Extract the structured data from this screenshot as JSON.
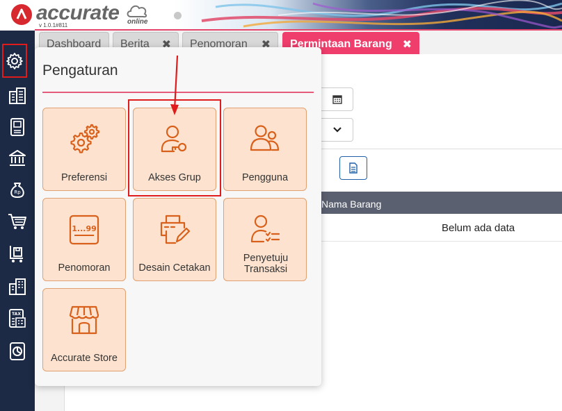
{
  "header": {
    "logo_text": "accurate",
    "logo_suffix": "online",
    "version": "v 1.0.1#811"
  },
  "tabs": [
    {
      "label": "Dashboard",
      "closable": false,
      "active": false
    },
    {
      "label": "Berita",
      "closable": true,
      "active": false
    },
    {
      "label": "Penomoran",
      "closable": true,
      "active": false
    },
    {
      "label": "Permintaan Barang",
      "closable": true,
      "active": true
    }
  ],
  "sidebar": {
    "items": [
      {
        "icon": "gear-icon",
        "active": true
      },
      {
        "icon": "building-icon"
      },
      {
        "icon": "ledger-book-icon"
      },
      {
        "icon": "bank-icon"
      },
      {
        "icon": "money-bag-icon"
      },
      {
        "icon": "shopping-cart-icon"
      },
      {
        "icon": "inventory-cart-icon"
      },
      {
        "icon": "warehouse-icon"
      },
      {
        "icon": "tax-icon"
      },
      {
        "icon": "report-chart-icon"
      }
    ]
  },
  "panel": {
    "title": "Pengaturan",
    "tiles": [
      {
        "label": "Preferensi",
        "icon": "gears-icon"
      },
      {
        "label": "Akses Grup",
        "icon": "user-key-icon",
        "highlighted": true
      },
      {
        "label": "Pengguna",
        "icon": "users-icon"
      },
      {
        "label": "Penomoran",
        "icon": "numbering-icon",
        "icon_text": "1...99"
      },
      {
        "label": "Desain Cetakan",
        "icon": "print-design-icon"
      },
      {
        "label": "Penyetuju Transaksi",
        "icon": "user-checklist-icon"
      },
      {
        "label": "Accurate Store",
        "icon": "store-icon"
      }
    ]
  },
  "grid": {
    "column_header": "Nama Barang",
    "empty_text": "Belum ada data"
  },
  "colors": {
    "sidebar": "#1c2a45",
    "accent": "#ef3d6c",
    "tile_bg": "#fde3cf",
    "tile_icon": "#d9601b",
    "highlight": "#e01b1b"
  }
}
